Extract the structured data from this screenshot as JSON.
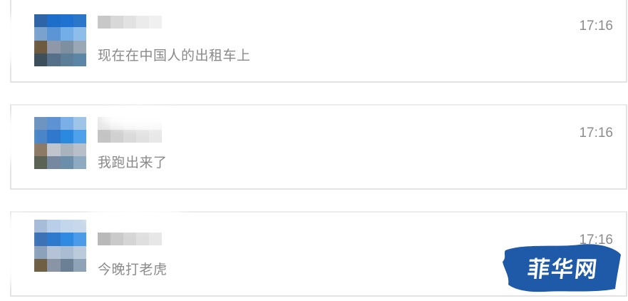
{
  "conversations": [
    {
      "message": "现在在中国人的出租车上",
      "time": "17:16"
    },
    {
      "message": "我跑出来了",
      "time": "17:16"
    },
    {
      "message": "今晚打老虎",
      "time": "17:16"
    }
  ],
  "avatar_icon": "pixelated-avatar",
  "watermark": {
    "text": "菲华网",
    "color": "#1e5aa8"
  }
}
